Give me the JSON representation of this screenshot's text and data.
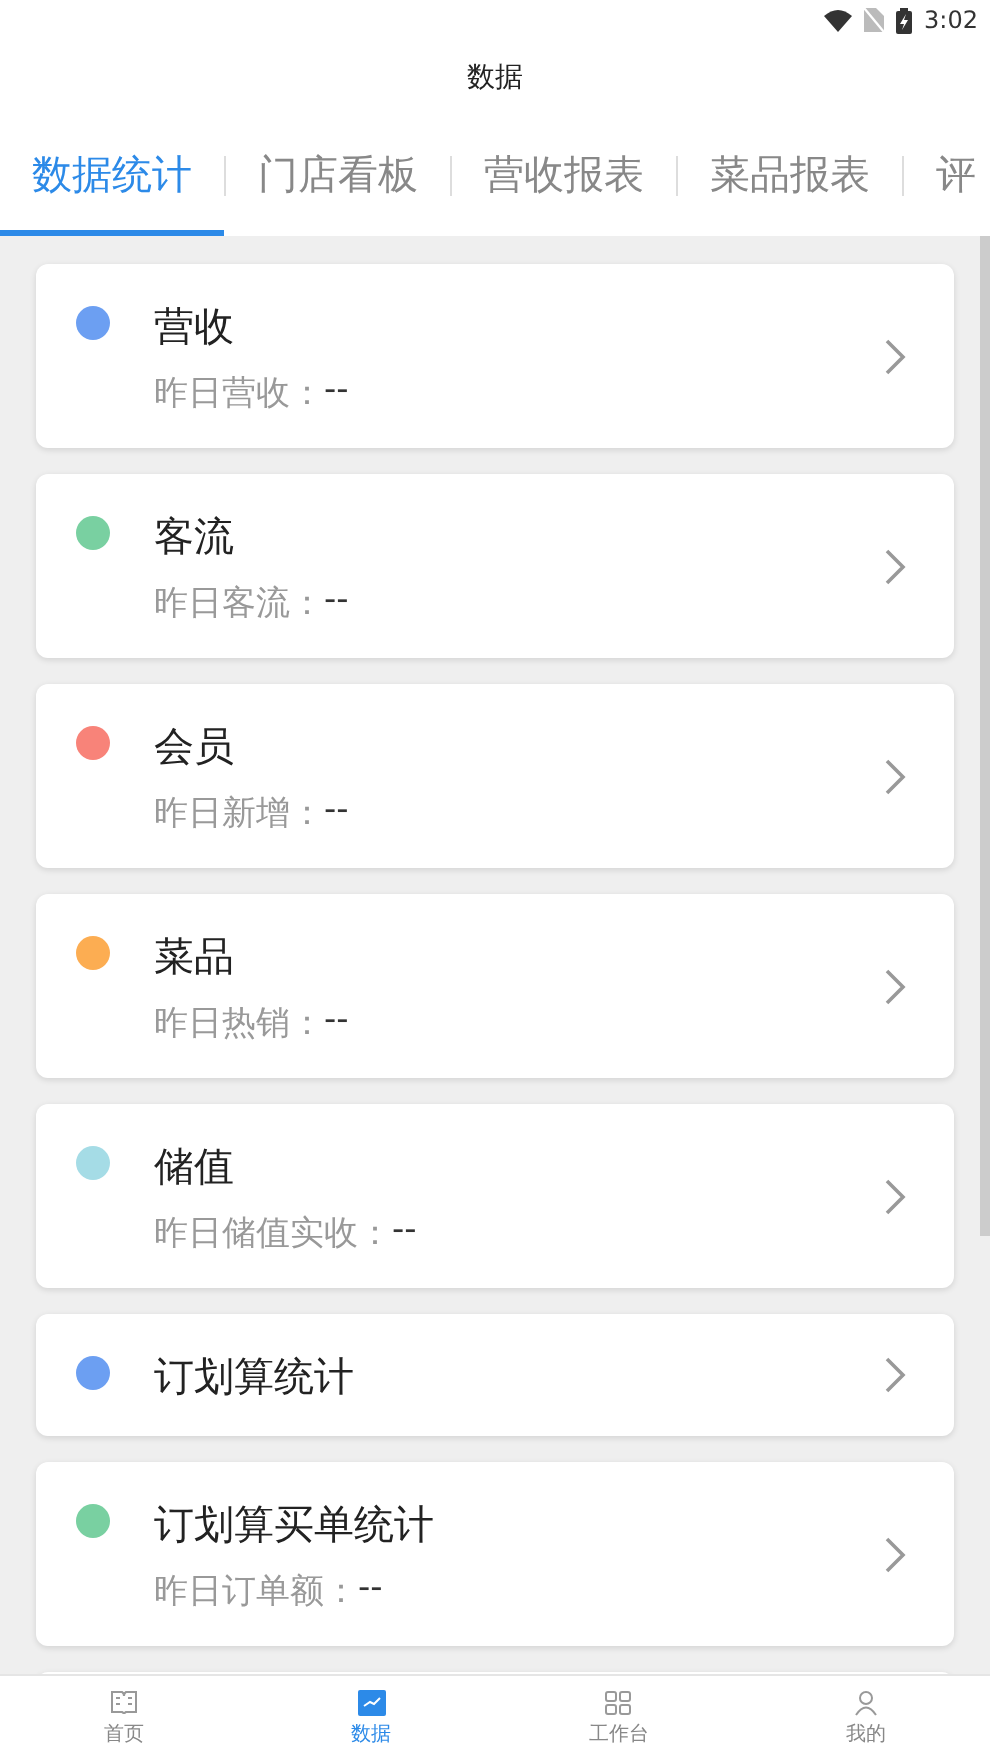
{
  "status_bar": {
    "time": "3:02"
  },
  "header": {
    "title": "数据"
  },
  "tabs": [
    {
      "label": "数据统计",
      "selected": true
    },
    {
      "label": "门店看板",
      "selected": false
    },
    {
      "label": "营收报表",
      "selected": false
    },
    {
      "label": "菜品报表",
      "selected": false
    },
    {
      "label": "评",
      "selected": false
    }
  ],
  "cards": [
    {
      "title": "营收",
      "color": "#6c9ff2",
      "label": "昨日营收：",
      "value": "--"
    },
    {
      "title": "客流",
      "color": "#79d0a1",
      "label": "昨日客流：",
      "value": "--"
    },
    {
      "title": "会员",
      "color": "#f88379",
      "label": "昨日新增：",
      "value": "--"
    },
    {
      "title": "菜品",
      "color": "#fcad52",
      "label": "昨日热销：",
      "value": "--"
    },
    {
      "title": "储值",
      "color": "#a5dce6",
      "label": "昨日储值实收：",
      "value": "--"
    },
    {
      "title": "订划算统计",
      "color": "#6c9ff2"
    },
    {
      "title": "订划算买单统计",
      "color": "#79d0a1",
      "label": "昨日订单额：",
      "value": "--"
    }
  ],
  "bottom_nav": [
    {
      "label": "首页",
      "kind": "book",
      "selected": false
    },
    {
      "label": "数据",
      "kind": "chart",
      "selected": true
    },
    {
      "label": "工作台",
      "kind": "grid",
      "selected": false
    },
    {
      "label": "我的",
      "kind": "person",
      "selected": false
    }
  ]
}
